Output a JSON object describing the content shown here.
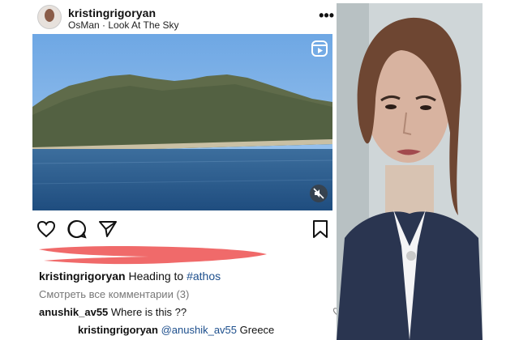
{
  "post": {
    "username": "kristingrigoryan",
    "audio": "OsMan · Look At The Sky",
    "more_label": "•••",
    "caption_user": "kristingrigoryan",
    "caption_text": "Heading to",
    "caption_tag": "#athos",
    "view_comments": "Смотреть все комментарии (3)",
    "comments": [
      {
        "user": "anushik_av55",
        "text": "Where is this ??"
      },
      {
        "user": "kristingrigoryan",
        "mention": "@anushik_av55",
        "text": "Greece"
      }
    ]
  },
  "icons": [
    "reel-icon",
    "mute-icon",
    "heart-icon",
    "comment-icon",
    "share-icon",
    "bookmark-icon",
    "more-icon"
  ],
  "colors": {
    "sea": "#2f5f8f",
    "sky": "#7fb2e6",
    "redaction": "#f06a6a",
    "tag": "#1c4e8c"
  }
}
